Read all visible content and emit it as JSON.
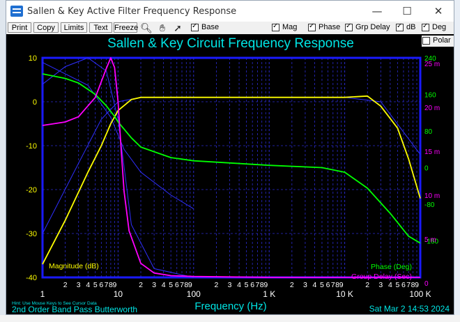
{
  "window": {
    "title": "Sallen & Key Active Filter Frequency Response",
    "minimize_icon": "minimize-icon",
    "maximize_icon": "maximize-icon",
    "close_icon": "close-icon"
  },
  "toolbar": {
    "buttons": [
      {
        "name": "print-button",
        "label": "Print"
      },
      {
        "name": "copy-button",
        "label": "Copy"
      },
      {
        "name": "limits-button",
        "label": "Limits"
      },
      {
        "name": "text-button",
        "label": "Text"
      },
      {
        "name": "freeze-button",
        "label": "Freeze"
      }
    ],
    "tools": [
      "zoom-icon",
      "pan-hand-icon",
      "pointer-icon"
    ],
    "checkboxes": [
      {
        "name": "base-checkbox",
        "label": "Base",
        "checked": true
      },
      {
        "name": "mag-checkbox",
        "label": "Mag",
        "checked": true
      },
      {
        "name": "phase-checkbox",
        "label": "Phase",
        "checked": true
      },
      {
        "name": "grp-delay-checkbox",
        "label": "Grp Delay",
        "checked": true
      },
      {
        "name": "db-checkbox",
        "label": "dB",
        "checked": true
      },
      {
        "name": "deg-checkbox",
        "label": "Deg",
        "checked": true
      },
      {
        "name": "polar-checkbox",
        "label": "Polar",
        "checked": false
      }
    ]
  },
  "plot": {
    "title": "Sallen & Key Circuit Frequency Response",
    "subtitle": "2nd Order Band Pass Butterworth",
    "hint": "Hint: Use Mouse Keys to See Cursor Data",
    "timestamp": "Sat Mar  2 14:53 2024",
    "xlabel": "Frequency (Hz)",
    "mag_label": "Magnitude (dB)",
    "phase_label": "Phase (Deg)",
    "delay_label": "Group Delay (Sec)",
    "x_major_ticks": [
      "1",
      "10",
      "100",
      "1 K",
      "10 K",
      "100 K"
    ],
    "x_minor_ticks": [
      "2",
      "3",
      "4",
      "5",
      "6",
      "7",
      "8",
      "9"
    ],
    "left_ticks": [
      "10",
      "0",
      "-10",
      "-20",
      "-30",
      "-40"
    ],
    "phase_ticks": [
      "240",
      "160",
      "80",
      "0",
      "-80",
      "-160"
    ],
    "delay_ticks": [
      "25 m",
      "20 m",
      "15 m",
      "10 m",
      "5 m",
      "0"
    ]
  },
  "colors": {
    "background": "#000000",
    "frame": "#1a1aff",
    "grid": "#2b2bd0",
    "title": "#00e5e5",
    "magnitude": "#ffff00",
    "phase": "#00ff00",
    "group_delay": "#ff00ff",
    "reference": "#2f2fff",
    "axis_text": "#ffffff"
  },
  "chart_data": {
    "type": "line",
    "xscale": "log",
    "xlim": [
      1,
      100000
    ],
    "y_axes": {
      "magnitude_db": [
        -40,
        10
      ],
      "phase_deg": [
        -240,
        240
      ],
      "group_delay_s": [
        0,
        0.025
      ]
    },
    "grid": true,
    "series": [
      {
        "name": "Magnitude (dB)",
        "axis": "magnitude_db",
        "x": [
          1,
          2,
          4,
          6,
          8,
          10,
          15,
          20,
          50,
          100,
          1000,
          10000,
          20000,
          30000,
          50000,
          70000,
          100000
        ],
        "values": [
          -37,
          -27,
          -16,
          -10,
          -5,
          -2,
          0.5,
          1,
          1,
          1,
          1,
          1,
          1.3,
          -1,
          -6,
          -13,
          -22
        ]
      },
      {
        "name": "Phase (Deg)",
        "axis": "phase_deg",
        "x": [
          1,
          2,
          3,
          5,
          7,
          9,
          10,
          15,
          20,
          50,
          100,
          1000,
          5000,
          10000,
          20000,
          40000,
          70000,
          100000
        ],
        "values": [
          205,
          195,
          185,
          160,
          135,
          112,
          100,
          65,
          45,
          22,
          15,
          5,
          0,
          -10,
          -45,
          -100,
          -150,
          -165
        ]
      },
      {
        "name": "Group Delay (Sec)",
        "axis": "group_delay_s",
        "x": [
          1,
          2,
          3,
          5,
          7,
          8,
          9,
          10,
          11,
          12,
          14,
          20,
          30,
          50,
          100,
          1000,
          10000,
          100000
        ],
        "values": [
          0.0173,
          0.0177,
          0.0183,
          0.0205,
          0.0238,
          0.025,
          0.0239,
          0.02,
          0.0145,
          0.0098,
          0.0053,
          0.0016,
          0.0005,
          0.0002,
          0.0001,
          0.0,
          0.0,
          0.0
        ]
      }
    ]
  }
}
